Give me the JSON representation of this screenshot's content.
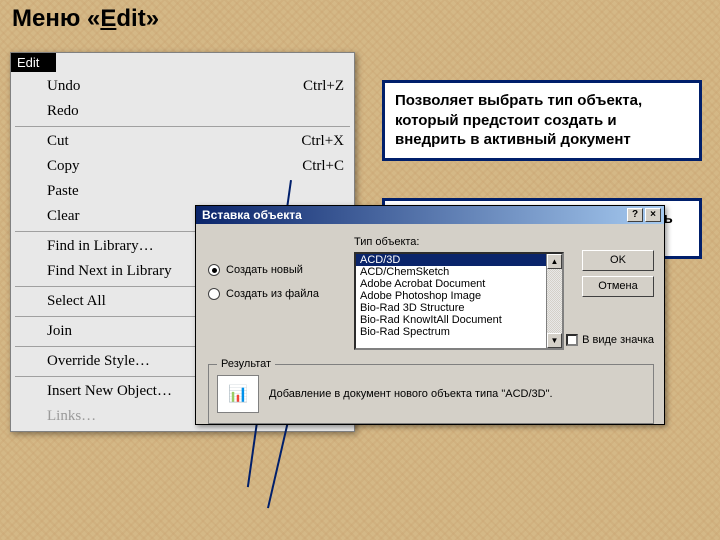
{
  "title": {
    "prefix": "Меню ",
    "quote_open": "«",
    "underline_char": "E",
    "rest": "dit",
    "quote_close": "»"
  },
  "menu": {
    "header": "Edit",
    "groups": [
      [
        {
          "label": "Undo",
          "shortcut": "Ctrl+Z",
          "disabled": false
        },
        {
          "label": "Redo",
          "shortcut": "",
          "disabled": false
        }
      ],
      [
        {
          "label": "Cut",
          "shortcut": "Ctrl+X",
          "disabled": false
        },
        {
          "label": "Copy",
          "shortcut": "Ctrl+C",
          "disabled": false
        },
        {
          "label": "Paste",
          "shortcut": "",
          "disabled": false
        },
        {
          "label": "Clear",
          "shortcut": "",
          "disabled": false
        }
      ],
      [
        {
          "label": "Find in Library…",
          "shortcut": "",
          "disabled": false
        },
        {
          "label": "Find Next in Library",
          "shortcut": "",
          "disabled": false
        }
      ],
      [
        {
          "label": "Select All",
          "shortcut": "",
          "disabled": false
        }
      ],
      [
        {
          "label": "Join",
          "shortcut": "",
          "disabled": false
        }
      ],
      [
        {
          "label": "Override Style…",
          "shortcut": "",
          "disabled": false
        }
      ],
      [
        {
          "label": "Insert New Object…",
          "shortcut": "",
          "disabled": false
        },
        {
          "label": "Links…",
          "shortcut": "",
          "disabled": true
        }
      ]
    ]
  },
  "callouts": {
    "c1": "Позволяет выбрать тип объекта, который предстоит создать и внедрить в активный документ",
    "c2": "Просматривает или обновляет связь объекта"
  },
  "dialog": {
    "title": "Вставка объекта",
    "help_glyph": "?",
    "close_glyph": "×",
    "radio_new": "Создать новый",
    "radio_file": "Создать из файла",
    "type_label": "Тип объекта:",
    "list": [
      "ACD/3D",
      "ACD/ChemSketch",
      "Adobe Acrobat Document",
      "Adobe Photoshop Image",
      "Bio-Rad 3D Structure",
      "Bio-Rad KnowItAll Document",
      "Bio-Rad Spectrum"
    ],
    "ok": "OK",
    "cancel": "Отмена",
    "as_icon": "В виде значка",
    "result_label": "Результат",
    "result_text": "Добавление в документ нового объекта типа \"ACD/3D\".",
    "icon_glyph": "📊"
  }
}
